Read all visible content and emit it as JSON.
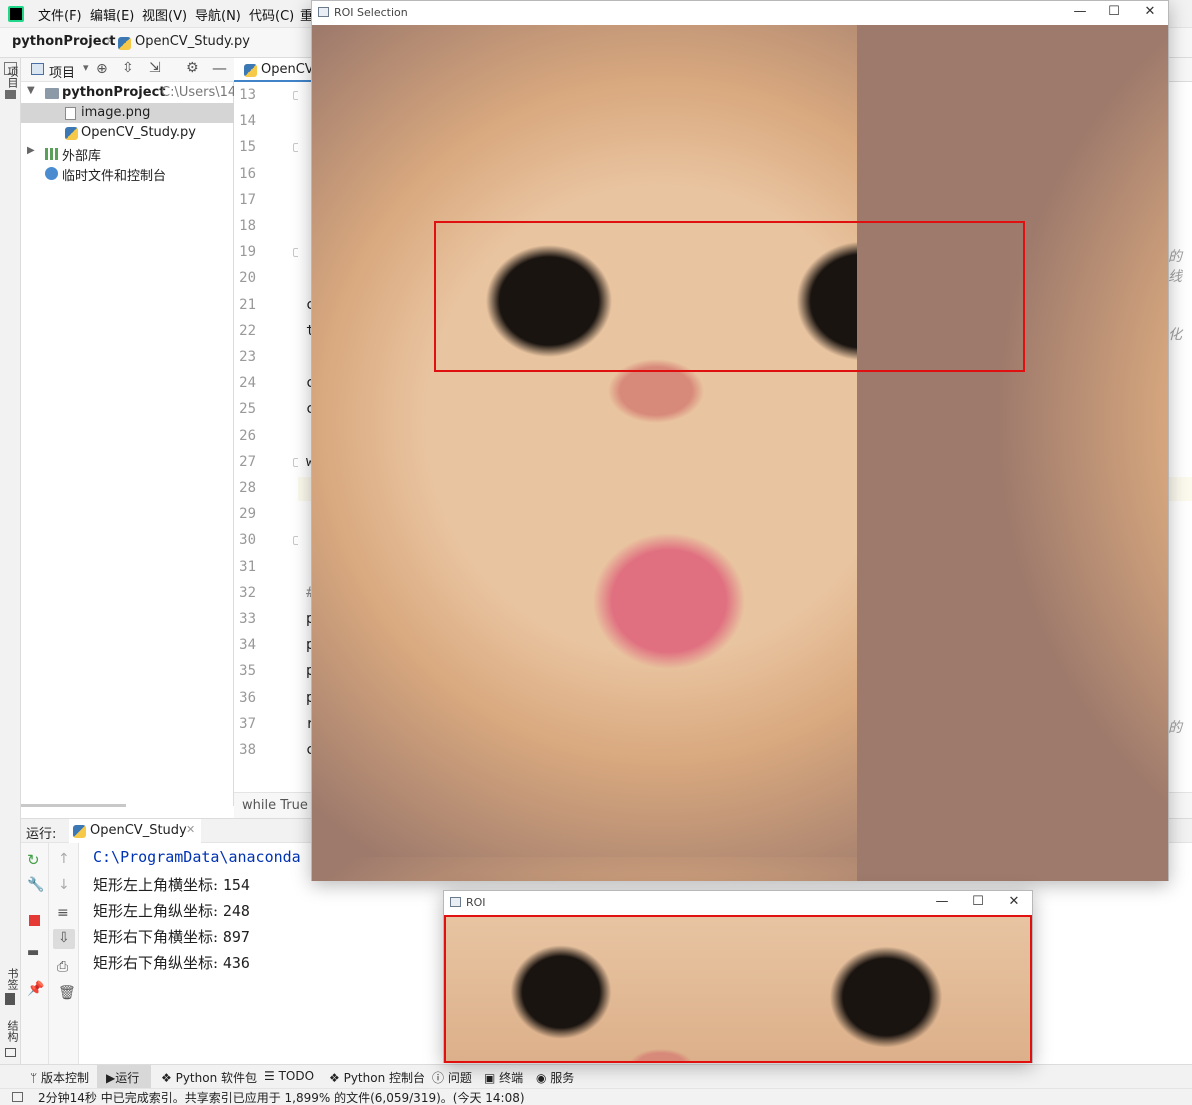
{
  "menu": {
    "items": [
      "文件(F)",
      "编辑(E)",
      "视图(V)",
      "导航(N)",
      "代码(C)",
      "重"
    ]
  },
  "breadcrumb": {
    "project": "pythonProject",
    "file": "OpenCV_Study.py"
  },
  "left_strip": {
    "project_label": "项目",
    "bookmarks_label": "书签",
    "structure_label": "结构"
  },
  "project_panel": {
    "toolbar_label": "项目",
    "root_name": "pythonProject",
    "root_path": "C:\\Users\\14",
    "items": [
      {
        "name": "image.png"
      },
      {
        "name": "OpenCV_Study.py"
      },
      {
        "name": "外部库"
      },
      {
        "name": "临时文件和控制台"
      }
    ]
  },
  "editor": {
    "tab_label": "OpenCV",
    "line_numbers": [
      "13",
      "14",
      "15",
      "16",
      "17",
      "18",
      "19",
      "20",
      "21",
      "22",
      "23",
      "24",
      "25",
      "26",
      "27",
      "28",
      "29",
      "30",
      "31",
      "32",
      "33",
      "34",
      "35",
      "36",
      "37",
      "38"
    ],
    "code_chars": [
      {
        "line": "21",
        "char": "c"
      },
      {
        "line": "22",
        "char": "t"
      },
      {
        "line": "24",
        "char": "c"
      },
      {
        "line": "25",
        "char": "c"
      },
      {
        "line": "27",
        "char": "w"
      },
      {
        "line": "32",
        "char": "#"
      },
      {
        "line": "33",
        "char": "p"
      },
      {
        "line": "34",
        "char": "p"
      },
      {
        "line": "35",
        "char": "p"
      },
      {
        "line": "36",
        "char": "p"
      },
      {
        "line": "37",
        "char": "r"
      },
      {
        "line": "38",
        "char": "c"
      }
    ],
    "right_comments": [
      "的线",
      "化",
      "的"
    ],
    "status_crumb": "while True"
  },
  "run_panel": {
    "label": "运行:",
    "tab_name": "OpenCV_Study",
    "console": {
      "first_line": "C:\\ProgramData\\anaconda",
      "lines": [
        {
          "label": "矩形左上角横坐标: ",
          "value": "154"
        },
        {
          "label": "矩形左上角纵坐标: ",
          "value": "248"
        },
        {
          "label": "矩形右下角横坐标: ",
          "value": "897"
        },
        {
          "label": "矩形右下角纵坐标: ",
          "value": "436"
        }
      ]
    }
  },
  "bottom_tabs": [
    "版本控制",
    "运行",
    "Python 软件包",
    "TODO",
    "Python 控制台",
    "问题",
    "终端",
    "服务"
  ],
  "status_bar": {
    "text": "2分钟14秒 中已完成索引。共享索引已应用于 1,899% 的文件(6,059/319)。(今天 14:08)"
  },
  "roi_selection_window": {
    "title": "ROI Selection",
    "image_label": "cat photo"
  },
  "roi_window": {
    "title": "ROI",
    "image_label": "cropped cat eyes"
  },
  "colors": {
    "selection_rect": "#e01010",
    "console_path": "#0033b3",
    "run_stop": "#e53935",
    "run_rerun": "#43a047"
  }
}
